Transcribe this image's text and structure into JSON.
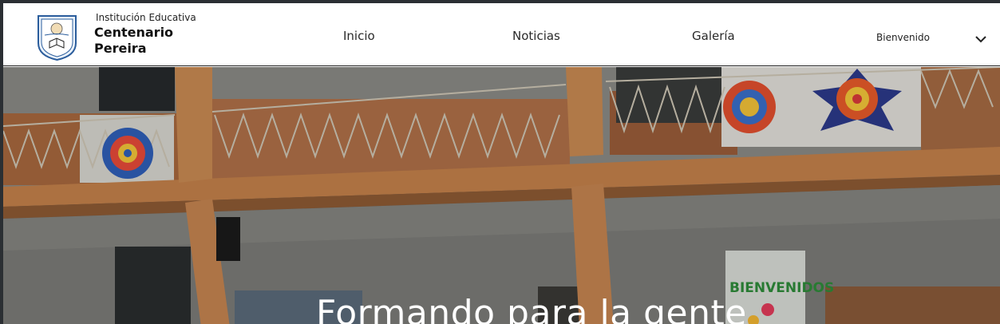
{
  "header": {
    "brand": {
      "subtitle": "Institución Educativa",
      "name_line1": "Centenario",
      "name_line2": "Pereira"
    },
    "nav": [
      {
        "label": "Inicio"
      },
      {
        "label": "Noticias"
      },
      {
        "label": "Galería"
      }
    ],
    "user_menu": {
      "label": "Bienvenido",
      "icon": "chevron-down-icon"
    }
  },
  "hero": {
    "title": "Formando para la gente",
    "mural_text": "BIENVENIDOS"
  },
  "colors": {
    "header_bg": "#ffffff",
    "accent_wood": "#c8864a",
    "hero_overlay": "#3a3a3a"
  }
}
